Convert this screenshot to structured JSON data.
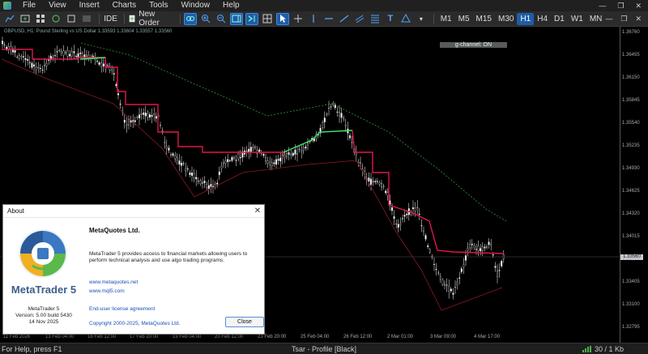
{
  "menu": {
    "items": [
      "File",
      "View",
      "Insert",
      "Charts",
      "Tools",
      "Window",
      "Help"
    ]
  },
  "toolbar": {
    "ide_label": "IDE",
    "new_order_label": "New Order",
    "timeframes": [
      "M1",
      "M5",
      "M15",
      "M30",
      "H1",
      "H4",
      "D1",
      "W1",
      "MN"
    ],
    "selected_timeframe": "H1"
  },
  "chart": {
    "info": "GBPUSD, H1:  Pound Sterling vs US Dollar  1.33593  1.33604  1.33557  1.33560",
    "indicator_label": "g-channel: ON",
    "current_price": "1.33560",
    "price_ticks": [
      "1.36760",
      "1.36455",
      "1.36150",
      "1.35845",
      "1.35540",
      "1.35235",
      "1.34930",
      "1.34625",
      "1.34320",
      "1.34015",
      "1.33710",
      "1.33405",
      "1.33100",
      "1.32795"
    ],
    "date_ticks": [
      "11 Feb 2026",
      "13 Feb 04:00",
      "16 Feb 12:00",
      "17 Feb 20:00",
      "19 Feb 04:00",
      "20 Feb 12:00",
      "23 Feb 20:00",
      "25 Feb 04:00",
      "26 Feb 12:00",
      "2 Mar 01:00",
      "3 Mar 09:00",
      "4 Mar 17:00"
    ],
    "colors": {
      "candles": "#ffffff",
      "channel_down": "#e0174a",
      "channel_up": "#3ee86a",
      "ma_upper": "#2e9b3a",
      "ma_lower": "#8b1a24",
      "price_line": "#555555"
    }
  },
  "about": {
    "window_title": "About",
    "brand": "MetaTrader 5",
    "product": "MetaTrader 5",
    "version": "Version: 5.00 build 5430",
    "date": "14 Nov 2025",
    "company": "MetaQuotes Ltd.",
    "description": "MetaTrader 5 provides access to financial markets allowing users to perform technical analysis and use algo trading programs.",
    "link1": "www.metaquotes.net",
    "link2": "www.mql5.com",
    "eula": "End-user license agreement",
    "copyright": "Copyright 2000-2025, MetaQuotes Ltd.",
    "close_label": "Close"
  },
  "status": {
    "help": "For Help, press F1",
    "profile": "Tsar - Profile [Black]",
    "traffic": "30 / 1 Kb"
  }
}
